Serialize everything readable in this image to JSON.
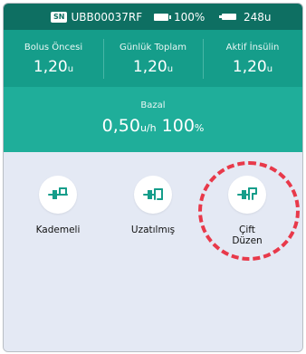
{
  "status_bar": {
    "serial_badge": "SN",
    "serial": "UBB00037RF",
    "battery": "100%",
    "reservoir": "248u"
  },
  "summary": [
    {
      "label": "Bolus Öncesi",
      "value": "1,20",
      "unit": "u"
    },
    {
      "label": "Günlük Toplam",
      "value": "1,20",
      "unit": "u"
    },
    {
      "label": "Aktif İnsülin",
      "value": "1,20",
      "unit": "u"
    }
  ],
  "basal": {
    "label": "Bazal",
    "value": "0,50",
    "unit": "u/h",
    "percent": "100",
    "percent_unit": "%"
  },
  "bolus_types": [
    {
      "label": "Kademeli",
      "icon": "syringe-icon"
    },
    {
      "label": "Uzatılmış",
      "icon": "extended-syringe-icon"
    },
    {
      "label": "Çift\nDüzen",
      "icon": "dual-syringe-icon",
      "highlighted": true
    }
  ],
  "colors": {
    "status_bar": "#0e6f62",
    "summary": "#159d8a",
    "basal": "#1fae9a",
    "icon": "#159d8a",
    "highlight": "#e8394a",
    "content_bg": "#e4e9f4"
  }
}
